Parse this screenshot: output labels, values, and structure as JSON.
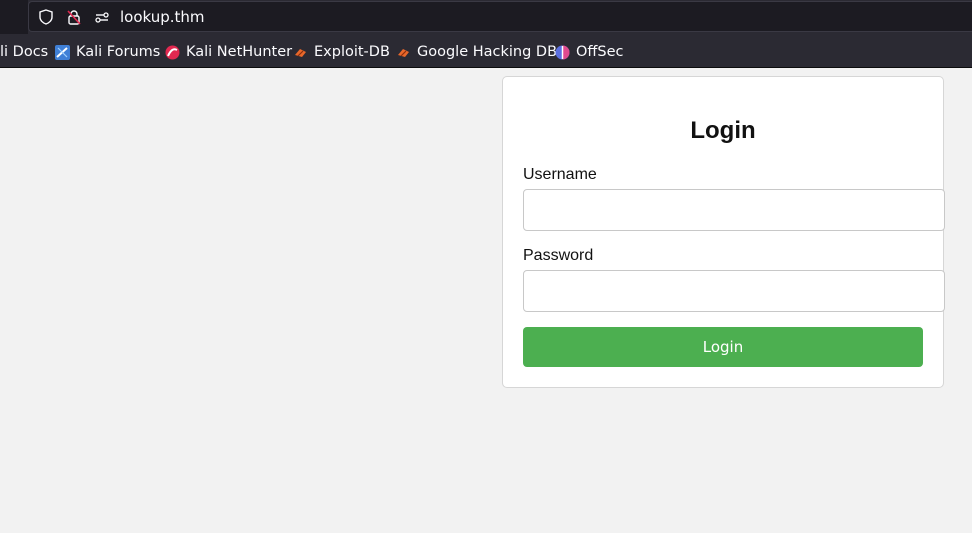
{
  "browser": {
    "url": "lookup.thm",
    "bookmarks": [
      {
        "label": "li Docs",
        "icon": "kali-docs-icon"
      },
      {
        "label": "Kali Forums",
        "icon": "kali-forums-icon"
      },
      {
        "label": "Kali NetHunter",
        "icon": "kali-nethunter-icon"
      },
      {
        "label": "Exploit-DB",
        "icon": "exploit-db-icon"
      },
      {
        "label": "Google Hacking DB",
        "icon": "google-hacking-db-icon"
      },
      {
        "label": "OffSec",
        "icon": "offsec-icon"
      }
    ]
  },
  "login": {
    "title": "Login",
    "username_label": "Username",
    "username_value": "",
    "password_label": "Password",
    "password_value": "",
    "button_label": "Login",
    "button_color": "#4caf50"
  }
}
